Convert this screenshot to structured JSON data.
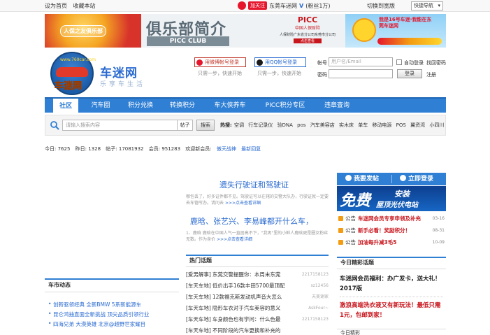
{
  "topbar": {
    "set_home": "设为首页",
    "bookmark": "收藏本站",
    "follow": "加关注",
    "weibo_name": "东莞车迷网",
    "weibo_v": "V",
    "fans": "(粉丝1万)",
    "switch_wide": "切换到宽版",
    "quick_nav": "快捷导航"
  },
  "banner": {
    "left_tag": "人保之友俱乐部",
    "title": "俱乐部简介",
    "subtitle": "PICC CLUB",
    "picc_logo": "PICC",
    "picc_cn": "中国人保财险",
    "picc_desc": "人保财险广东省分公司东莞市分公司",
    "picc_more": "点击查看",
    "right_text": "我是16号车迷·我能在东莞车迷网",
    "colors": {
      "brand_red": "#d7332b",
      "picc_red": "#c8161d",
      "gray_title": "#5a6a75"
    }
  },
  "site": {
    "logo_url": "www.769car.com",
    "logo_text": "车迷网",
    "name": "车迷网",
    "slogan": "乐享车生活"
  },
  "social": {
    "weibo_login": "用微博帐号登录",
    "qq_login": "用QQ帐号登录",
    "step_text": "只需一步，快速开始"
  },
  "login": {
    "account_label": "帐号",
    "account_placeholder": "用户名/Email",
    "auto_login": "自动登录",
    "forgot": "找回密码",
    "password_label": "密码",
    "login_btn": "登录",
    "register": "注册"
  },
  "nav": {
    "items": [
      {
        "label": "社区"
      },
      {
        "label": "汽车圈"
      },
      {
        "label": "积分兑换"
      },
      {
        "label": "转换积分"
      },
      {
        "label": "车大侠养车"
      },
      {
        "label": "PICC积分专区"
      },
      {
        "label": "违章查询"
      }
    ]
  },
  "search": {
    "placeholder": "请输入搜索内容",
    "type": "帖子",
    "btn": "搜索",
    "hot_label": "热搜:",
    "hot": [
      "空调",
      "行车记录仪",
      "验DNA",
      "pos",
      "汽车美容店",
      "实木床",
      "单车",
      "移动电源",
      "POS",
      "翼资湾",
      "小四川"
    ]
  },
  "stats": {
    "today": "今日: 7625",
    "yesterday": "昨日: 1328",
    "posts": "帖子: 17081932",
    "members": "会员: 951283",
    "welcome": "欢迎新会员:",
    "new_member": "傲天战神",
    "latest": "最新回复"
  },
  "main": {
    "article1_title": "遗失行驶证和驾驶证",
    "article1_desc": "哪包丢了，好多证件都不见。驾驶证可以在辖的交警大队办，行驶证就一定要去车管所办。请问去",
    "article1_more": ">>>点击查看详细",
    "article2_title": "鹿晗、张艺兴、李易峰都开什么车，",
    "article2_desc": "1、鹿晗 鹿晗在中国人气一直居高不下，\"我男\"里的小鲜人鹿晗更是圈女粉丝无数。作为身价",
    "article2_more": ">>>点击查看详细",
    "hot_topics_header": "热门话题",
    "hot_topics": [
      {
        "tag": "[爱男解事]",
        "title": "东莞交警提醒你：本周末东莞",
        "author": "2217158123"
      },
      {
        "tag": "[车天车地]",
        "title": "低价出手16款丰田5700最顶配",
        "author": "sz12456"
      },
      {
        "tag": "[车天车地]",
        "title": "12款福克斯发动机声音大怎么",
        "author": "天美谢家"
      },
      {
        "tag": "[车天车地]",
        "title": "隐形车衣对于汽车美容的意义",
        "author": "AskFour~"
      },
      {
        "tag": "[车天车地]",
        "title": "车身颜色也有学问：什么色最",
        "author": "2217158123"
      },
      {
        "tag": "[车天车地]",
        "title": "不同阶段的汽车更换和补充的",
        "author": ""
      }
    ]
  },
  "left": {
    "car_news_header": "车市动态",
    "car_news": [
      "创新驱领经典 全新BMW 5系新能源车",
      "昆仑鸿抽直面全新挑战 顶尖品质引领行业",
      "四海兄弟 大漠英雄 北京@越野世家耀目"
    ]
  },
  "right": {
    "post_btn": "我要发帖",
    "login_btn": "立即登录",
    "ad_big": "免费",
    "ad_line1": "安装",
    "ad_line2": "屋顶光伏电站",
    "notices": [
      {
        "label": "公告",
        "title": "车迷网会员专享申领及补充",
        "date": "03-16"
      },
      {
        "label": "公告",
        "title": "新手必看！奖励积分！",
        "date": "08-31"
      },
      {
        "label": "公告",
        "title": "加油每升减3毛5",
        "date": "10-09"
      }
    ],
    "today_header": "今日精彩话题",
    "today_1": "车迷网会员福利：办广发卡，送大礼！2017版",
    "today_2": "激浪高端洗衣液又有新玩法！最低只需1元，包邮到家！",
    "today_next": "今日精彩"
  }
}
